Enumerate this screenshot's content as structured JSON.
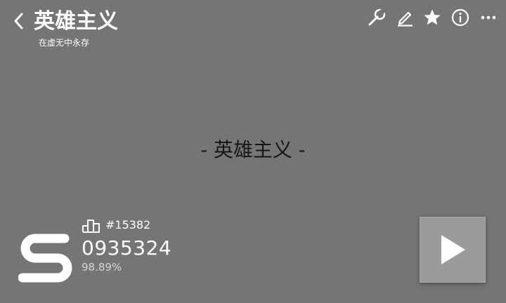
{
  "header": {
    "title": "英雄主义",
    "subtitle": "在虚无中永存",
    "icons": [
      "back-icon",
      "wrench-icon",
      "edit-icon",
      "star-icon",
      "info-icon",
      "more-icon"
    ]
  },
  "content": {
    "center_title": "- 英雄主义 -"
  },
  "result": {
    "grade": "S",
    "rank": "#15382",
    "score": "0935324",
    "accuracy": "98.89%"
  },
  "colors": {
    "background": "#757575",
    "foreground": "#ffffff",
    "play_button": "#9b9b9b",
    "center_title": "#161616"
  }
}
